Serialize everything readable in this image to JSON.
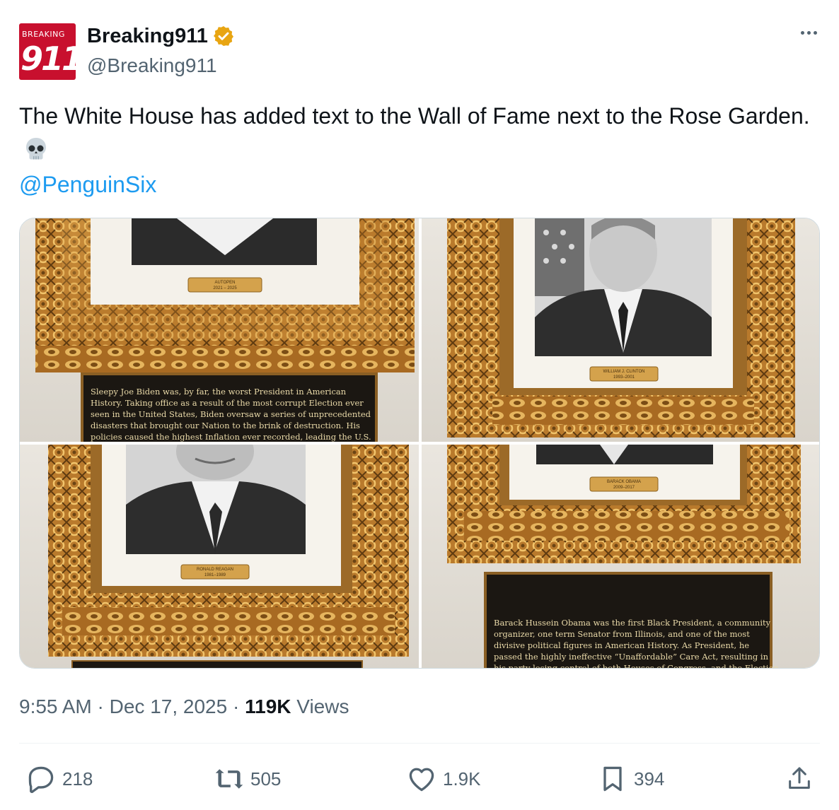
{
  "author": {
    "avatar_top_text": "BREAKING",
    "avatar_number": "911",
    "display_name": "Breaking911",
    "handle": "@Breaking911",
    "verified_color": "#f4b400"
  },
  "tweet": {
    "text": "The White House has added text to the Wall of Fame next to the Rose Garden.",
    "emoji": "skull-emoji",
    "mention": "@PenguinSix"
  },
  "media": {
    "images": [
      {
        "nameplate": [
          "AUTOPEN",
          "2021 – 2025"
        ],
        "plaque_lines": [
          "Sleepy Joe Biden was, by far, the worst President in American",
          "History. Taking office as a result of the most corrupt Election ever",
          "seen in the United States, Biden oversaw a series of unprecedented",
          "disasters that brought our Nation to the brink of destruction. His",
          "policies caused the highest Inflation ever recorded, leading the U.S."
        ]
      },
      {
        "nameplate": [
          "WILLIAM J. CLINTON",
          "1993–2001"
        ],
        "plaque_lines": []
      },
      {
        "nameplate": [
          "RONALD REAGAN",
          "1981–1989"
        ],
        "plaque_lines": []
      },
      {
        "nameplate": [
          "BARACK OBAMA",
          "2009–2017"
        ],
        "plaque_lines": [
          "Barack Hussein Obama was the first Black President, a community",
          "organizer, one term Senator from Illinois, and one of the most",
          "divisive political figures in American History. As President, he",
          "passed the highly ineffective “Unaffordable” Care Act, resulting in",
          "his party losing control of both Houses of Congress, and the Election"
        ]
      }
    ]
  },
  "meta": {
    "time": "9:55 AM",
    "separator": "·",
    "date": "Dec 17, 2025",
    "views_count": "119K",
    "views_label": "Views"
  },
  "actions": {
    "replies": "218",
    "reposts": "505",
    "likes": "1.9K",
    "bookmarks": "394"
  },
  "colors": {
    "link": "#1d9bf0",
    "secondary_text": "#536471",
    "frame_gold": "#b8822e",
    "plaque_black": "#1b1712"
  }
}
